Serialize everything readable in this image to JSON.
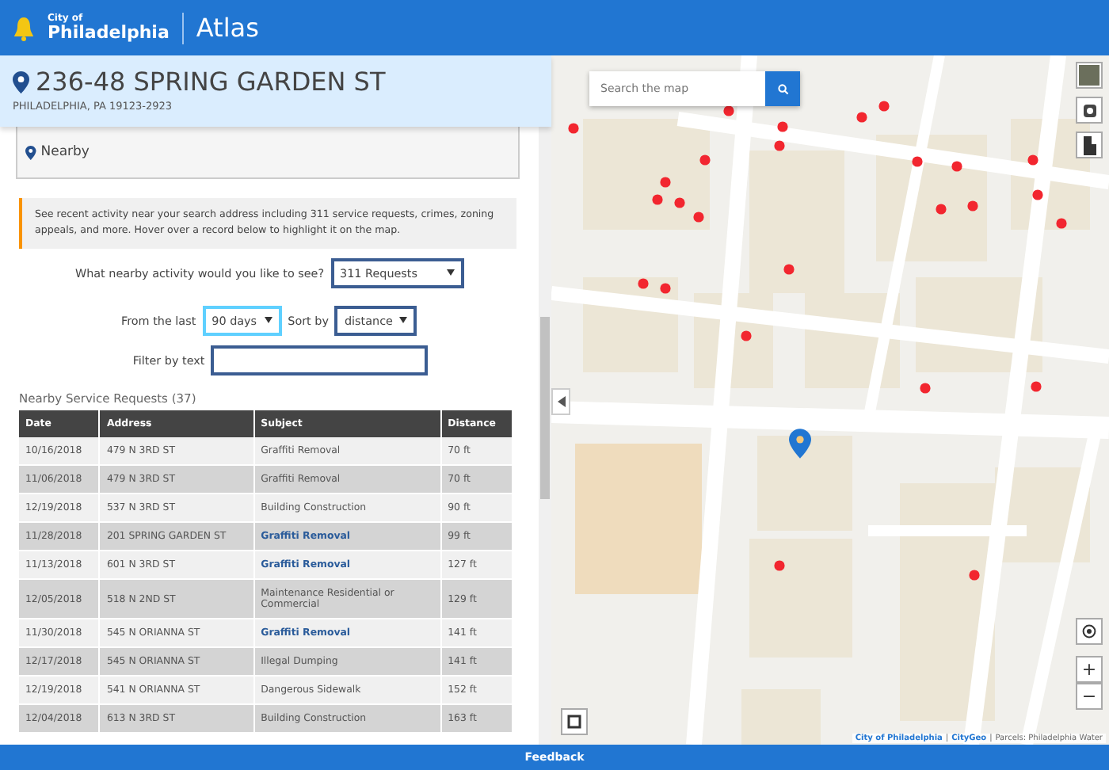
{
  "header": {
    "logo_small": "City of",
    "logo_big": "Philadelphia",
    "app_title": "Atlas"
  },
  "address": {
    "title": "236-48 SPRING GARDEN ST",
    "subtitle": "PHILADELPHIA, PA 19123-2923"
  },
  "topic": {
    "label": "Nearby",
    "expanded": true
  },
  "callout": "See recent activity near your search address including 311 service requests, crimes, zoning appeals, and more. Hover over a record below to highlight it on the map.",
  "activity": {
    "label": "What nearby activity would you like to see?",
    "value": "311 Requests"
  },
  "time": {
    "label": "From the last",
    "value": "90 days",
    "focused": true
  },
  "sort": {
    "label": "Sort by",
    "value": "distance"
  },
  "filter": {
    "label": "Filter by text"
  },
  "table": {
    "title": "Nearby Service Requests (37)",
    "columns": [
      "Date",
      "Address",
      "Subject",
      "Distance"
    ],
    "rows": [
      {
        "cells": [
          "10/16/2018",
          "479 N 3RD ST",
          "Graffiti Removal",
          "70 ft"
        ],
        "link": false
      },
      {
        "cells": [
          "11/06/2018",
          "479 N 3RD ST",
          "Graffiti Removal",
          "70 ft"
        ],
        "link": false
      },
      {
        "cells": [
          "12/19/2018",
          "537 N 3RD ST",
          "Building Construction",
          "90 ft"
        ],
        "link": false
      },
      {
        "cells": [
          "11/28/2018",
          "201 SPRING GARDEN ST",
          "Graffiti Removal",
          "99 ft"
        ],
        "link": true
      },
      {
        "cells": [
          "11/13/2018",
          "601 N 3RD ST",
          "Graffiti Removal",
          "127 ft"
        ],
        "link": true
      },
      {
        "cells": [
          "12/05/2018",
          "518 N 2ND ST",
          "Maintenance Residential or Commercial",
          "129 ft"
        ],
        "link": false
      },
      {
        "cells": [
          "11/30/2018",
          "545 N ORIANNA ST",
          "Graffiti Removal",
          "141 ft"
        ],
        "link": true
      },
      {
        "cells": [
          "12/17/2018",
          "545 N ORIANNA ST",
          "Illegal Dumping",
          "141 ft"
        ],
        "link": false
      },
      {
        "cells": [
          "12/19/2018",
          "541 N ORIANNA ST",
          "Dangerous Sidewalk",
          "152 ft"
        ],
        "link": false
      },
      {
        "cells": [
          "12/04/2018",
          "613 N 3RD ST",
          "Building Construction",
          "163 ft"
        ],
        "link": false
      }
    ]
  },
  "map": {
    "search_placeholder": "Search the map",
    "zoom_in": "+",
    "zoom_out": "−",
    "attribution_separator": "|",
    "attribution": [
      {
        "text": "City of Philadelphia",
        "link": true
      },
      {
        "text": "CityGeo",
        "link": true
      },
      {
        "text": "Parcels: Philadelphia Water",
        "link": false
      }
    ]
  },
  "footer": {
    "label": "Feedback"
  }
}
